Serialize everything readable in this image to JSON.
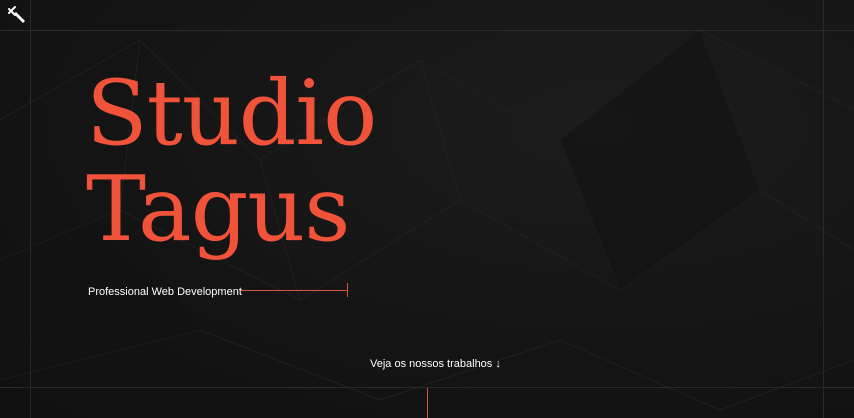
{
  "logo": {
    "icon": "brush-icon"
  },
  "hero": {
    "title_line1": "Studio",
    "title_line2": "Tagus",
    "tagline": "Professional Web Development"
  },
  "cta": {
    "label": "Veja os nossos trabalhos ↓"
  },
  "colors": {
    "accent": "#f0533a",
    "background": "#161616",
    "text": "#ffffff"
  }
}
